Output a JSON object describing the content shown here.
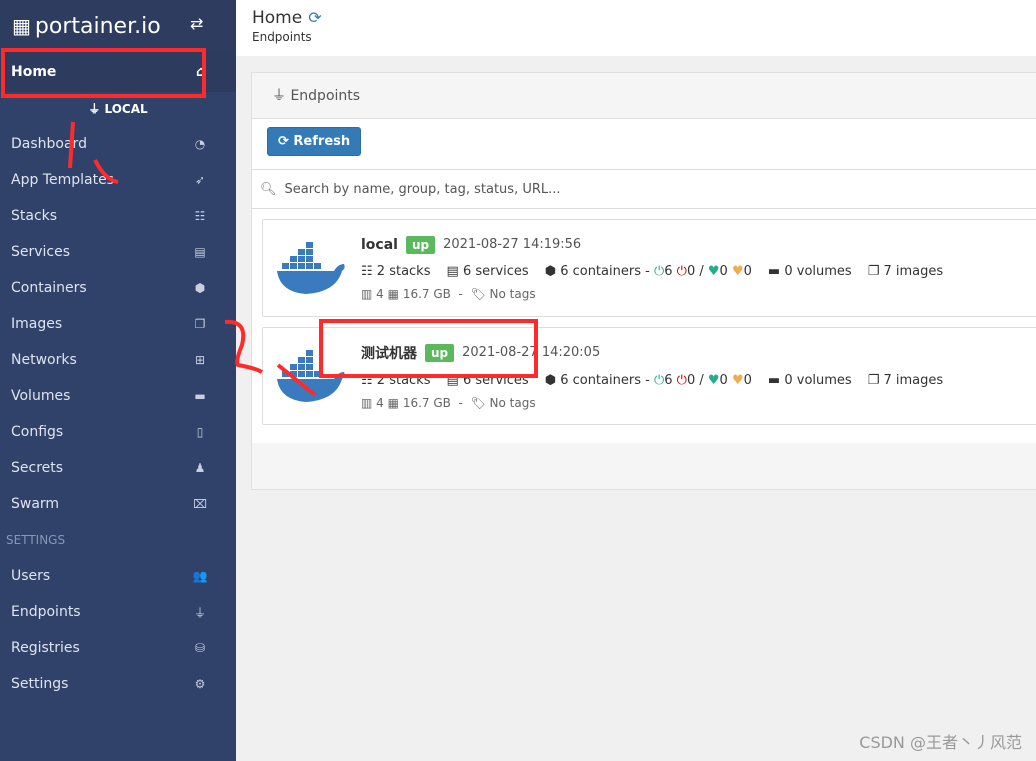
{
  "sidebar": {
    "brand": "portainer.io",
    "home": "Home",
    "endpoint": "LOCAL",
    "items": [
      {
        "label": "Dashboard",
        "icon": "tachometer-icon",
        "glyph": "◔"
      },
      {
        "label": "App Templates",
        "icon": "rocket-icon",
        "glyph": "➶"
      },
      {
        "label": "Stacks",
        "icon": "th-list-icon",
        "glyph": "☷"
      },
      {
        "label": "Services",
        "icon": "list-alt-icon",
        "glyph": "▤"
      },
      {
        "label": "Containers",
        "icon": "cubes-icon",
        "glyph": "⬢"
      },
      {
        "label": "Images",
        "icon": "clone-icon",
        "glyph": "❐"
      },
      {
        "label": "Networks",
        "icon": "sitemap-icon",
        "glyph": "⊞"
      },
      {
        "label": "Volumes",
        "icon": "hdd-icon",
        "glyph": "▬"
      },
      {
        "label": "Configs",
        "icon": "file-code-icon",
        "glyph": "▯"
      },
      {
        "label": "Secrets",
        "icon": "user-secret-icon",
        "glyph": "♟"
      },
      {
        "label": "Swarm",
        "icon": "object-group-icon",
        "glyph": "⌧"
      }
    ],
    "settings_label": "SETTINGS",
    "settings": [
      {
        "label": "Users",
        "icon": "users-icon",
        "glyph": "👥"
      },
      {
        "label": "Endpoints",
        "icon": "plug-icon",
        "glyph": "⏚"
      },
      {
        "label": "Registries",
        "icon": "database-icon",
        "glyph": "⛁"
      },
      {
        "label": "Settings",
        "icon": "cogs-icon",
        "glyph": "⚙"
      }
    ]
  },
  "header": {
    "title": "Home",
    "subtitle": "Endpoints"
  },
  "panel": {
    "title": "Endpoints",
    "refresh": "Refresh",
    "search_placeholder": "Search by name, group, tag, status, URL..."
  },
  "endpoints": [
    {
      "name": "local",
      "status": "up",
      "time": "2021-08-27 14:19:56",
      "stacks": "2 stacks",
      "services": "6 services",
      "containers": "6 containers -",
      "running": "6",
      "stopped": "0 /",
      "healthy": "0",
      "unhealthy": "0",
      "volumes": "0 volumes",
      "images": "7 images",
      "cpu": "4",
      "mem": "16.7 GB",
      "tags": "No tags"
    },
    {
      "name": "测试机器",
      "status": "up",
      "time": "2021-08-27 14:20:05",
      "stacks": "2 stacks",
      "services": "6 services",
      "containers": "6 containers -",
      "running": "6",
      "stopped": "0 /",
      "healthy": "0",
      "unhealthy": "0",
      "volumes": "0 volumes",
      "images": "7 images",
      "cpu": "4",
      "mem": "16.7 GB",
      "tags": "No tags"
    }
  ],
  "watermark": "CSDN @王者丶丿风范",
  "colors": {
    "sidebar": "#30426a",
    "primary": "#337ab7",
    "up": "#5cb85c",
    "annotation": "#ff2b2b"
  }
}
